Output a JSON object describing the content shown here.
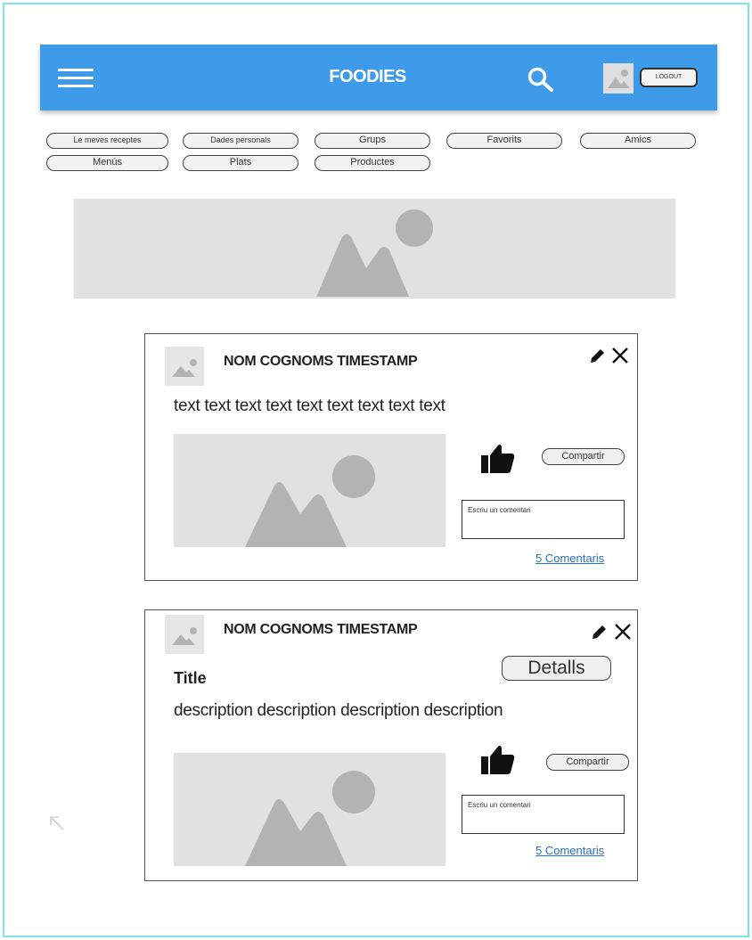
{
  "header": {
    "title": "FOODIES",
    "logout_label": "LOGOUT",
    "icons": [
      "hamburger-menu-icon",
      "search-icon",
      "image-icon"
    ],
    "background_color": "#3d9be9"
  },
  "nav": {
    "items": [
      {
        "label": "Le meves receptes"
      },
      {
        "label": "Dades personals"
      },
      {
        "label": "Grups"
      },
      {
        "label": "Favorits"
      },
      {
        "label": "Amics"
      },
      {
        "label": "Menús"
      },
      {
        "label": "Plats"
      },
      {
        "label": "Productes"
      }
    ]
  },
  "posts": [
    {
      "author": "NOM COGNOMS   TIMESTAMP",
      "text": "text   text  text  text  text  text  text  text  text",
      "share_label": "Compartir",
      "comment_placeholder": "Escriu un comentari",
      "comments_link": "5 Comentaris"
    },
    {
      "author": "NOM COGNOMS   TIMESTAMP",
      "title": "Title",
      "description": "description   description  description  description",
      "details_label": "Detalls",
      "share_label": "Compartir",
      "comment_placeholder": "Escriu un comentari",
      "comments_link": "5 Comentaris"
    }
  ],
  "colors": {
    "frame_border": "#7fe3ec",
    "placeholder_bg": "#e1e1e1",
    "placeholder_shape": "#b3b3b3",
    "link": "#2a6fc9"
  }
}
